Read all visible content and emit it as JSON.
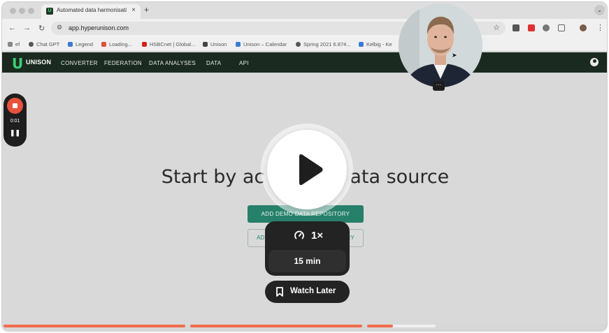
{
  "browser": {
    "tab_title": "Automated data harmonisatio",
    "tab_favicon_letter": "U",
    "new_tab_symbol": "+",
    "close_symbol": "×",
    "url": "app.hyperunison.com",
    "bookmarks": [
      {
        "label": "ef"
      },
      {
        "label": "Chat GPT"
      },
      {
        "label": "Legend"
      },
      {
        "label": "Loading..."
      },
      {
        "label": "HSBCnet | Global..."
      },
      {
        "label": "Unison"
      },
      {
        "label": "Unison – Calendar"
      },
      {
        "label": "Spring 2021 6.874..."
      },
      {
        "label": "Kelbig - Ke"
      }
    ]
  },
  "app_nav": {
    "logo_letter": "U",
    "logo_text": "UNISON",
    "items": [
      "CONVERTER",
      "FEDERATION",
      "DATA ANALYSES",
      "DATA",
      "API"
    ]
  },
  "main": {
    "headline_left": "Start by ac",
    "headline_right": "ata source",
    "demo_button": "ADD DEMO DATA REPOSITORY",
    "outline_button_left": "AD",
    "outline_button_right": "RY"
  },
  "recorder": {
    "time": "0:01",
    "pause_symbol": "❚❚"
  },
  "player": {
    "speed": "1×",
    "duration": "15 min",
    "watch_later": "Watch Later"
  },
  "colors": {
    "accent": "#27806a",
    "nav_bg": "#1a2a20",
    "progress": "#f26a4b",
    "record": "#e8523c"
  }
}
